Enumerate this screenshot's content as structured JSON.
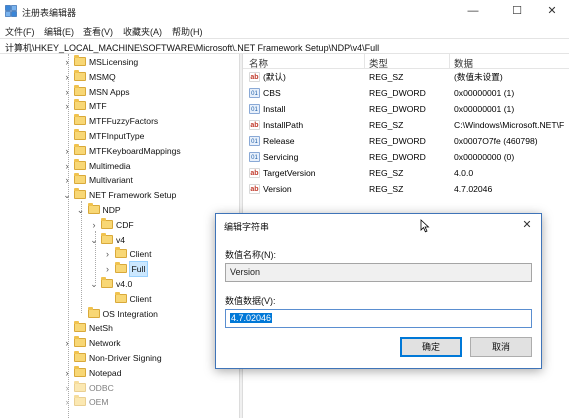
{
  "window": {
    "title": "注册表编辑器",
    "minimize": "—",
    "maximize": "☐",
    "close": "✕"
  },
  "menu": [
    "文件(F)",
    "编辑(E)",
    "查看(V)",
    "收藏夹(A)",
    "帮助(H)"
  ],
  "address": "计算机\\HKEY_LOCAL_MACHINE\\SOFTWARE\\Microsoft\\.NET Framework Setup\\NDP\\v4\\Full",
  "tree": [
    {
      "label": "MSLicensing",
      "depth": 0,
      "expander": "chevron-right"
    },
    {
      "label": "MSMQ",
      "depth": 0,
      "expander": "chevron-right"
    },
    {
      "label": "MSN Apps",
      "depth": 0,
      "expander": "chevron-right"
    },
    {
      "label": "MTF",
      "depth": 0,
      "expander": "chevron-right"
    },
    {
      "label": "MTFFuzzyFactors",
      "depth": 0,
      "expander": "none"
    },
    {
      "label": "MTFInputType",
      "depth": 0,
      "expander": "none"
    },
    {
      "label": "MTFKeyboardMappings",
      "depth": 0,
      "expander": "chevron-right"
    },
    {
      "label": "Multimedia",
      "depth": 0,
      "expander": "chevron-right"
    },
    {
      "label": "Multivariant",
      "depth": 0,
      "expander": "chevron-right"
    },
    {
      "label": "NET Framework Setup",
      "depth": 0,
      "expander": "chevron-down"
    },
    {
      "label": "NDP",
      "depth": 1,
      "expander": "chevron-down"
    },
    {
      "label": "CDF",
      "depth": 2,
      "expander": "chevron-right"
    },
    {
      "label": "v4",
      "depth": 2,
      "expander": "chevron-down"
    },
    {
      "label": "Client",
      "depth": 3,
      "expander": "chevron-right"
    },
    {
      "label": "Full",
      "depth": 3,
      "expander": "chevron-right",
      "selected": true
    },
    {
      "label": "v4.0",
      "depth": 2,
      "expander": "chevron-down"
    },
    {
      "label": "Client",
      "depth": 3,
      "expander": "none"
    },
    {
      "label": "OS Integration",
      "depth": 1,
      "expander": "none"
    },
    {
      "label": "NetSh",
      "depth": 0,
      "expander": "none"
    },
    {
      "label": "Network",
      "depth": 0,
      "expander": "chevron-right"
    },
    {
      "label": "Non-Driver Signing",
      "depth": 0,
      "expander": "none"
    },
    {
      "label": "Notepad",
      "depth": 0,
      "expander": "chevron-right"
    },
    {
      "label": "ODBC",
      "depth": 0,
      "expander": "chevron-right",
      "faded": true
    },
    {
      "label": "OEM",
      "depth": 0,
      "expander": "chevron-right",
      "faded": true
    }
  ],
  "columns": {
    "name": "名称",
    "type": "类型",
    "data": "数据"
  },
  "values": [
    {
      "icon": "string-value-icon",
      "name": "(默认)",
      "type": "REG_SZ",
      "data": "(数值未设置)"
    },
    {
      "icon": "dword-value-icon",
      "name": "CBS",
      "type": "REG_DWORD",
      "data": "0x00000001 (1)"
    },
    {
      "icon": "dword-value-icon",
      "name": "Install",
      "type": "REG_DWORD",
      "data": "0x00000001 (1)"
    },
    {
      "icon": "string-value-icon",
      "name": "InstallPath",
      "type": "REG_SZ",
      "data": "C:\\Windows\\Microsoft.NET\\F"
    },
    {
      "icon": "dword-value-icon",
      "name": "Release",
      "type": "REG_DWORD",
      "data": "0x0007O7fe (460798)"
    },
    {
      "icon": "dword-value-icon",
      "name": "Servicing",
      "type": "REG_DWORD",
      "data": "0x00000000 (0)"
    },
    {
      "icon": "string-value-icon",
      "name": "TargetVersion",
      "type": "REG_SZ",
      "data": "4.0.0"
    },
    {
      "icon": "string-value-icon",
      "name": "Version",
      "type": "REG_SZ",
      "data": "4.7.02046"
    }
  ],
  "dialog": {
    "title": "编辑字符串",
    "close": "✕",
    "name_label": "数值名称(N):",
    "name_value": "Version",
    "data_label": "数值数据(V):",
    "data_value": "4.7.02046",
    "ok": "确定",
    "cancel": "取消"
  },
  "watermark": "",
  "colors": {
    "selection": "#cce8ff",
    "text_selection": "#0078d7",
    "dialog_border": "#3f74b8",
    "folder": "#f8d775"
  }
}
